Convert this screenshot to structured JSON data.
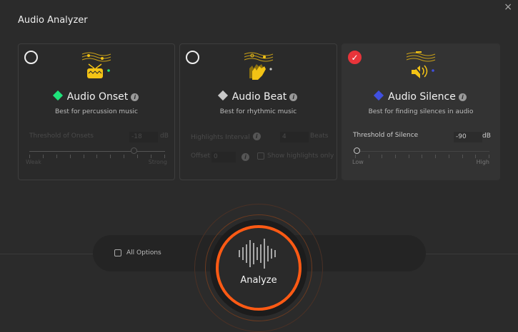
{
  "window": {
    "title": "Audio Analyzer",
    "close": "×"
  },
  "cards": [
    {
      "name": "Audio Onset",
      "desc": "Best for percussion music",
      "color": "#1ee37a",
      "selected": false,
      "threshold_label": "Threshold of Onsets",
      "value": "-18",
      "unit": "dB",
      "min_label": "Weak",
      "max_label": "Strong",
      "slider_fraction": 0.84
    },
    {
      "name": "Audio Beat",
      "desc": "Best for rhythmic music",
      "color": "#c8c8c8",
      "selected": false,
      "interval_label": "Highlights Interval",
      "interval_value": "4",
      "interval_unit": "Beats",
      "offset_label": "Offset",
      "offset_value": "0",
      "show_label": "Show highlights only"
    },
    {
      "name": "Audio Silence",
      "desc": "Best for finding silences in audio",
      "color": "#4050e0",
      "selected": true,
      "threshold_label": "Threshold of Silence",
      "value": "-90",
      "unit": "dB",
      "min_label": "Low",
      "max_label": "High",
      "slider_fraction": 0.0
    }
  ],
  "footer": {
    "all_options": "All Options",
    "analyze": "Analyze",
    "accent": "#ff5a14"
  }
}
